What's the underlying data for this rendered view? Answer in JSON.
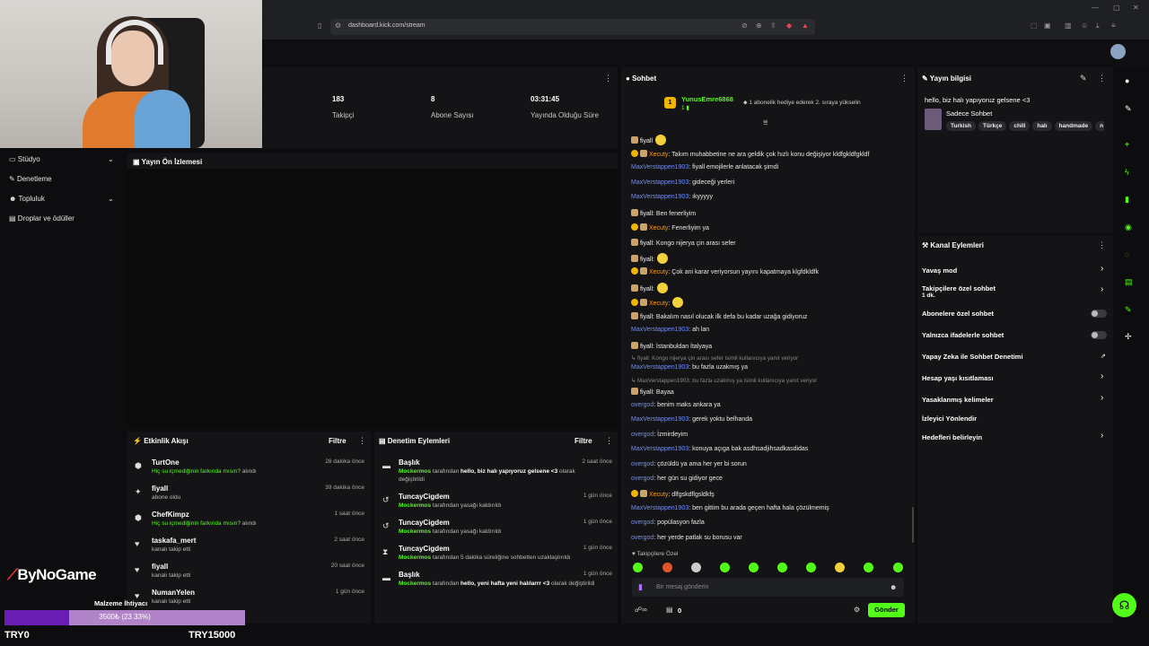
{
  "browser": {
    "url": "dashboard.kick.com/stream"
  },
  "sidebar": {
    "items": [
      {
        "label": "Stüdyo",
        "icon": "camera-icon",
        "chevron": true
      },
      {
        "label": "Denetleme",
        "icon": "wrench-icon",
        "chevron": false
      },
      {
        "label": "Topluluk",
        "icon": "users-icon",
        "chevron": true
      },
      {
        "label": "Droplar ve ödüller",
        "icon": "gift-icon",
        "chevron": false
      }
    ]
  },
  "stats": [
    {
      "value": "183",
      "label": "Takipçi"
    },
    {
      "value": "8",
      "label": "Abone Sayısı"
    },
    {
      "value": "03:31:45",
      "label": "Yayında Olduğu Süre"
    }
  ],
  "preview": {
    "title": "Yayın Ön İzlemesi"
  },
  "activity": {
    "title": "Etkinlik Akışı",
    "filter": "Filtre",
    "items": [
      {
        "name": "TurtOne",
        "highlight": "Hiç su içmediğinin farkında mısın?",
        "desc": " alındı",
        "time": "28 dakika önce",
        "icon": "reward-icon"
      },
      {
        "name": "fiyall",
        "highlight": "",
        "desc": "abone oldu",
        "time": "39 dakika önce",
        "icon": "star-icon"
      },
      {
        "name": "ChefKimpz",
        "highlight": "Hiç su içmediğinin farkında mısın?",
        "desc": " alındı",
        "time": "1 saat önce",
        "icon": "reward-icon"
      },
      {
        "name": "taskafa_mert",
        "highlight": "",
        "desc": "kanalı takip etti",
        "time": "2 saat önce",
        "icon": "heart-icon"
      },
      {
        "name": "fiyall",
        "highlight": "",
        "desc": "kanalı takip etti",
        "time": "20 saat önce",
        "icon": "heart-icon"
      },
      {
        "name": "NumanYelen",
        "highlight": "",
        "desc": "kanalı takip etti",
        "time": "1 gün önce",
        "icon": "heart-icon"
      }
    ]
  },
  "moderation": {
    "title": "Denetim Eylemleri",
    "filter": "Filtre",
    "items": [
      {
        "name": "Başlık",
        "actor": "Mockermos",
        "desc": " tarafından ",
        "bold": "hello, biz halı yapıyoruz gelsene <3",
        "tail": " olarak değiştirildi",
        "time": "2 saat önce",
        "icon": "title-icon"
      },
      {
        "name": "TuncayCigdem",
        "actor": "Mockermos",
        "desc": " tarafından yasağı kaldırıldı",
        "bold": "",
        "tail": "",
        "time": "1 gün önce",
        "icon": "undo-icon"
      },
      {
        "name": "TuncayCigdem",
        "actor": "Mockermos",
        "desc": " tarafından yasağı kaldırıldı",
        "bold": "",
        "tail": "",
        "time": "1 gün önce",
        "icon": "undo-icon"
      },
      {
        "name": "TuncayCigdem",
        "actor": "Mockermos",
        "desc": " tarafından 5 dakika süreliğine sohbetten uzaklaştırıldı",
        "bold": "",
        "tail": "",
        "time": "1 gün önce",
        "icon": "hourglass-icon"
      },
      {
        "name": "Başlık",
        "actor": "Mockermos",
        "desc": " tarafından ",
        "bold": "hello, yeni hafta yeni halılarrr <3",
        "tail": " olarak değiştirildi",
        "time": "1 gün önce",
        "icon": "title-icon"
      }
    ]
  },
  "chat": {
    "title": "Sohbet",
    "pinned_user": "YunusEmre6868",
    "pinned_rank": "1",
    "pinned_text": "1 abonelik hediye ederek 2. sıraya yükselin",
    "messages": [
      {
        "user": "fiyall",
        "cls": "u-f",
        "text": "",
        "badge": "b",
        "emote": true
      },
      {
        "user": "Xecuty",
        "cls": "u-x",
        "text": ": Takım muhabbetine ne ara geldik çok hızlı konu değişiyor kldfgkldfgkldf",
        "badge": "o",
        "emote": false
      },
      {
        "user": "MaxVerstappen1903",
        "cls": "u-m",
        "text": ": fiyall emojilerle anlatacak şimdi",
        "badge": "",
        "emote": false
      },
      {
        "user": "MaxVerstappen1903",
        "cls": "u-m",
        "text": ": gideceği yerleri",
        "badge": "",
        "emote": false
      },
      {
        "user": "MaxVerstappen1903",
        "cls": "u-m",
        "text": ": ıkyyyyy",
        "badge": "",
        "emote": false
      },
      {
        "user": "fiyall",
        "cls": "u-f",
        "text": ": Ben fenerliyim",
        "badge": "b",
        "emote": false
      },
      {
        "user": "Xecuty",
        "cls": "u-x",
        "text": ": Fenerliyim ya",
        "badge": "o",
        "emote": false
      },
      {
        "user": "fiyall",
        "cls": "u-f",
        "text": ": Kongo nijerya çin arası sefer",
        "badge": "b",
        "emote": false
      },
      {
        "user": "fiyall",
        "cls": "u-f",
        "text": ":",
        "badge": "b",
        "emote": true
      },
      {
        "user": "Xecuty",
        "cls": "u-x",
        "text": ": Çok ani karar veriyorsun yayını kapatmaya klgfdkldfk",
        "badge": "o",
        "emote": false
      },
      {
        "user": "fiyall",
        "cls": "u-f",
        "text": ":",
        "badge": "b",
        "emote": true
      },
      {
        "user": "Xecuty",
        "cls": "u-x",
        "text": ":",
        "badge": "o",
        "emote": true
      },
      {
        "user": "fiyall",
        "cls": "u-f",
        "text": ": Bakalım nasıl olucak ilk defa bu kadar uzağa gidiyoruz",
        "badge": "b",
        "emote": false
      },
      {
        "user": "MaxVerstappen1903",
        "cls": "u-m",
        "text": ": ah lan",
        "badge": "",
        "emote": false
      },
      {
        "user": "fiyall",
        "cls": "u-f",
        "text": ": İstanbuldan İtalyaya",
        "badge": "b",
        "emote": false
      }
    ],
    "reply1": "↳ fiyall: Kongo nijerya çin arası sefer isimli kullanıcıya yanıt veriyor",
    "reply1_user": "MaxVerstappen1903",
    "reply1_text": ": bu fazla uzakmış ya",
    "reply2": "↳ MaxVerstappen1903: bu fazla uzakmış ya isimli kullanıcıya yanıt veriyor",
    "reply2_user": "fiyall",
    "reply2_text": ": Bayaa",
    "messages2": [
      {
        "user": "overgod",
        "cls": "u-o",
        "text": ": benim maks ankara ya",
        "badge": ""
      },
      {
        "user": "MaxVerstappen1903",
        "cls": "u-m",
        "text": ": gerek yoktu belhanda",
        "badge": ""
      },
      {
        "user": "overgod",
        "cls": "u-o",
        "text": ": İzmirdeyim",
        "badge": ""
      },
      {
        "user": "MaxVerstappen1903",
        "cls": "u-m",
        "text": ": konuya açıga bak asdhsadjihsadkasdidas",
        "badge": ""
      },
      {
        "user": "overgod",
        "cls": "u-o",
        "text": ": çözüldü ya ama her yer bi sorun",
        "badge": ""
      },
      {
        "user": "overgod",
        "cls": "u-o",
        "text": ": her gün su gidiyor gece",
        "badge": ""
      },
      {
        "user": "Xecuty",
        "cls": "u-x",
        "text": ": dlfgskdflgsldkfş",
        "badge": "o"
      },
      {
        "user": "MaxVerstappen1903",
        "cls": "u-m",
        "text": ": ben gittim bu arada geçen hafta hala çözülmemiş",
        "badge": ""
      },
      {
        "user": "overgod",
        "cls": "u-o",
        "text": ": popülasyon fazla",
        "badge": ""
      },
      {
        "user": "overgod",
        "cls": "u-o",
        "text": ": her yerde patlak su borusu var",
        "badge": ""
      }
    ],
    "followers_only": "♥ Takipçilere Özel",
    "input_placeholder": "Bir mesaj gönderin",
    "count": "0",
    "send": "Gönder"
  },
  "stream_info": {
    "title": "Yayın bilgisi",
    "stream_title": "hello, biz halı yapıyoruz gelsene <3",
    "category": "Sadece Sohbet",
    "tags": [
      "Turkish",
      "Türkçe",
      "chill",
      "halı",
      "handmade",
      "n"
    ]
  },
  "channel_actions": {
    "title": "Kanal Eylemleri",
    "items": [
      {
        "label": "Yavaş mod",
        "kind": "chevron"
      },
      {
        "label": "Takipçilere özel sohbet",
        "sub": "1 dk.",
        "kind": "chevron"
      },
      {
        "label": "Abonelere özel sohbet",
        "kind": "toggle"
      },
      {
        "label": "Yalnızca ifadelerle sohbet",
        "kind": "toggle"
      },
      {
        "label": "Yapay Zeka ile Sohbet Denetimi",
        "kind": "external"
      },
      {
        "label": "Hesap yaşı kısıtlaması",
        "kind": "chevron"
      },
      {
        "label": "Yasaklanmış kelimeler",
        "kind": "chevron"
      },
      {
        "label": "İzleyici Yönlendir",
        "kind": "none"
      },
      {
        "label": "Hedefleri belirleyin",
        "kind": "chevron"
      }
    ]
  },
  "overlay": {
    "logo": "ByNoGame",
    "goal_label": "Malzeme İhtiyacı",
    "goal_text": "3500₺ (23.33%)",
    "goal_progress": 0.2333,
    "min": "TRY0",
    "max": "TRY15000"
  },
  "colors": {
    "accent": "#53fc18",
    "chat_blue": "#6f8dff",
    "chat_orange": "#ff9d1e"
  }
}
